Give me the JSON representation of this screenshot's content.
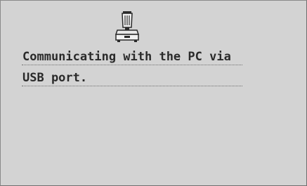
{
  "screen": {
    "icon": "usb-communication-icon",
    "message_lines": [
      "Communicating with the PC via",
      "USB port."
    ]
  },
  "colors": {
    "background": "#d3d3d3",
    "text": "#2a2a2a"
  }
}
